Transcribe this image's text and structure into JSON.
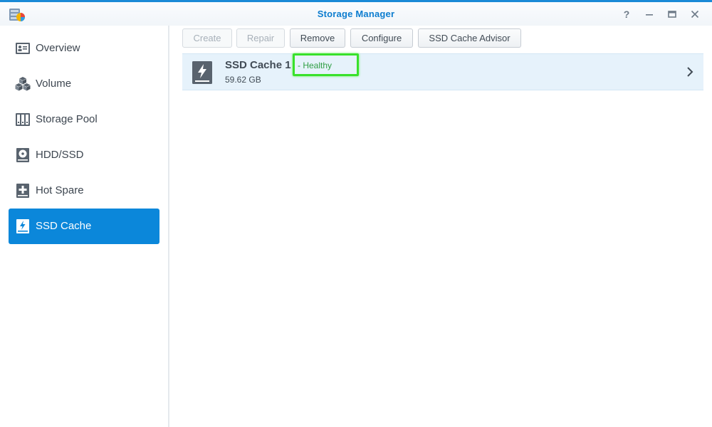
{
  "window": {
    "title": "Storage Manager",
    "controls": [
      "help-icon",
      "minimize-icon",
      "maximize-icon",
      "close-icon"
    ],
    "help_glyph": "?"
  },
  "sidebar": {
    "items": [
      {
        "label": "Overview",
        "icon": "overview-icon",
        "active": false
      },
      {
        "label": "Volume",
        "icon": "volume-icon",
        "active": false
      },
      {
        "label": "Storage Pool",
        "icon": "storage-pool-icon",
        "active": false
      },
      {
        "label": "HDD/SSD",
        "icon": "hdd-ssd-icon",
        "active": false
      },
      {
        "label": "Hot Spare",
        "icon": "hot-spare-icon",
        "active": false
      },
      {
        "label": "SSD Cache",
        "icon": "ssd-cache-icon",
        "active": true
      }
    ]
  },
  "toolbar": {
    "buttons": [
      {
        "label": "Create",
        "enabled": false
      },
      {
        "label": "Repair",
        "enabled": false
      },
      {
        "label": "Remove",
        "enabled": true
      },
      {
        "label": "Configure",
        "enabled": true
      },
      {
        "label": "SSD Cache Advisor",
        "enabled": true
      }
    ]
  },
  "caches": [
    {
      "name": "SSD Cache 1",
      "status": "- Healthy",
      "size": "59.62 GB",
      "icon": "ssd-cache-drive-icon"
    }
  ],
  "colors": {
    "accent": "#0b87da",
    "title": "#0d7dcf",
    "healthy": "#2f9e44",
    "highlight": "#39e12b",
    "row_selected": "#e6f2fb"
  }
}
